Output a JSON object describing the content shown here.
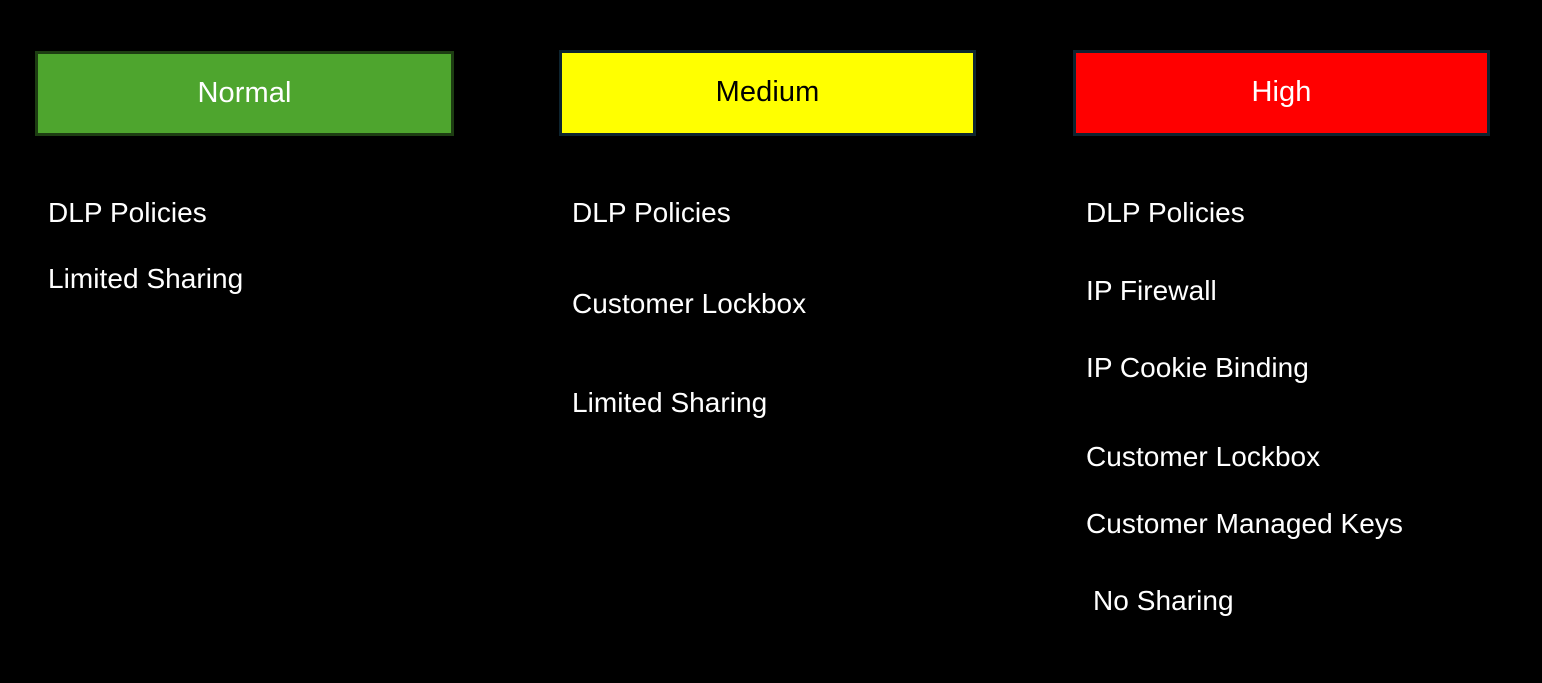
{
  "background_color": "#000000",
  "text_color": "#ffffff",
  "columns": [
    {
      "id": "normal",
      "header": {
        "label": "Normal",
        "fill_color": "#4EA52E",
        "border_color": "#1d3d12",
        "text_color": "#ffffff"
      },
      "items": [
        {
          "label": "DLP Policies",
          "indented": false
        },
        {
          "label": "Limited Sharing",
          "indented": false
        }
      ]
    },
    {
      "id": "medium",
      "header": {
        "label": "Medium",
        "fill_color": "#FFFF00",
        "border_color": "#0d2430",
        "text_color": "#000000"
      },
      "items": [
        {
          "label": "DLP Policies",
          "indented": false
        },
        {
          "label": "Customer Lockbox",
          "indented": false
        },
        {
          "label": "Limited Sharing",
          "indented": false
        }
      ]
    },
    {
      "id": "high",
      "header": {
        "label": "High",
        "fill_color": "#FF0000",
        "border_color": "#0d2430",
        "text_color": "#ffffff"
      },
      "items": [
        {
          "label": "DLP Policies",
          "indented": false
        },
        {
          "label": "IP Firewall",
          "indented": false
        },
        {
          "label": "IP Cookie Binding",
          "indented": false
        },
        {
          "label": "Customer Lockbox",
          "indented": false
        },
        {
          "label": "Customer Managed Keys",
          "indented": false
        },
        {
          "label": "No Sharing",
          "indented": true
        }
      ]
    }
  ]
}
